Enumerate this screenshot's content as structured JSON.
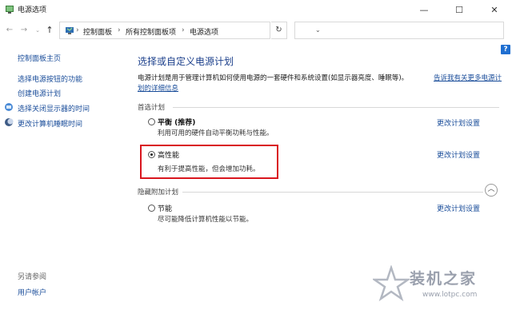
{
  "window": {
    "title": "电源选项",
    "min_label": "—",
    "max_label": "☐",
    "close_label": "✕"
  },
  "nav": {
    "back": "←",
    "forward": "→",
    "recent": "⌄",
    "up": "↑",
    "breadcrumbs": [
      "控制面板",
      "所有控制面板项",
      "电源选项"
    ],
    "separator": "›",
    "address_dropdown": "⌄",
    "refresh": "↻",
    "search_placeholder": ""
  },
  "help_label": "?",
  "sidebar": {
    "home": "控制面板主页",
    "items": [
      "选择电源按钮的功能",
      "创建电源计划",
      "选择关闭显示器的时间",
      "更改计算机睡眠时间"
    ],
    "see_also": "另请参阅",
    "see_also_items": [
      "用户帐户"
    ]
  },
  "main": {
    "heading": "选择或自定义电源计划",
    "description": "电源计划是用于管理计算机如何使用电源的一套硬件和系统设置(如显示器亮度、睡眠等)。",
    "description_link_1": "告诉我有关更多电源计",
    "description_link_2": "划的详细信息",
    "preferred_section": "首选计划",
    "hidden_section": "隐藏附加计划",
    "collapse": "︿",
    "plans": [
      {
        "name": "平衡 (推荐)",
        "desc": "利用可用的硬件自动平衡功耗与性能。",
        "selected": false,
        "change": "更改计划设置"
      },
      {
        "name": "高性能",
        "desc": "有利于提高性能，但会增加功耗。",
        "selected": true,
        "change": "更改计划设置"
      },
      {
        "name": "节能",
        "desc": "尽可能降低计算机性能以节能。",
        "selected": false,
        "change": "更改计划设置"
      }
    ]
  },
  "watermark": {
    "title": "装机之家",
    "url": "www.lotpc.com"
  },
  "colors": {
    "link": "#1a4d9a",
    "heading": "#1b3f8b",
    "highlight_box": "#d9161e",
    "help_button": "#1f6fd1"
  }
}
